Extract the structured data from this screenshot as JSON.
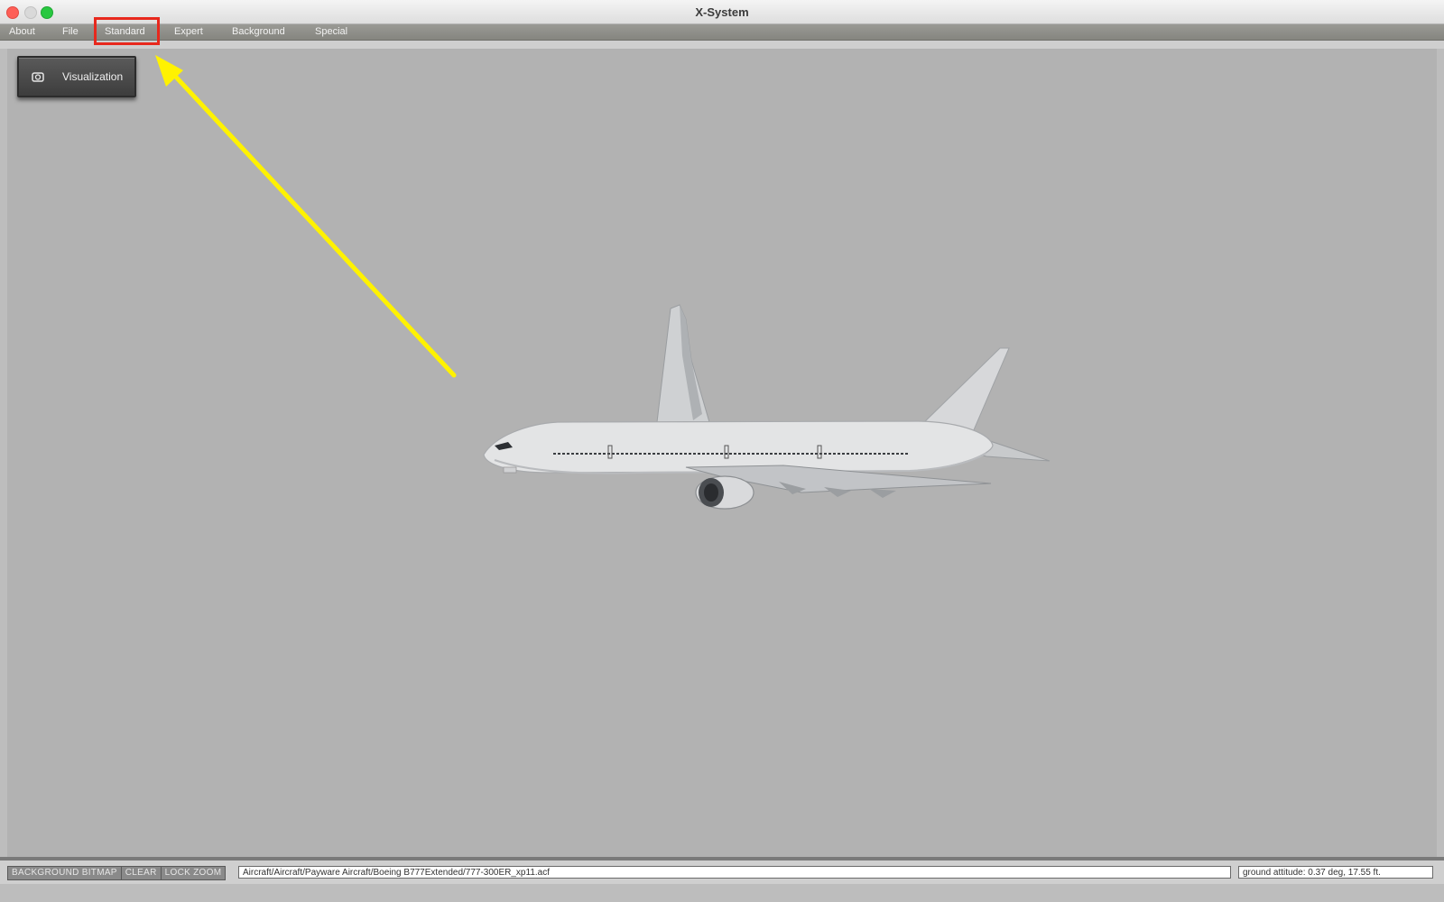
{
  "window": {
    "title": "X-System"
  },
  "menu": {
    "items": [
      "About",
      "File",
      "Standard",
      "Expert",
      "Background",
      "Special"
    ]
  },
  "viewport": {
    "visualization_label": "Visualization"
  },
  "statusbar": {
    "buttons": [
      "BACKGROUND BITMAP",
      "CLEAR",
      "LOCK ZOOM"
    ],
    "path": "Aircraft/Aircraft/Payware Aircraft/Boeing B777Extended/777-300ER_xp11.acf",
    "attitude": "ground attitude: 0.37 deg, 17.55 ft."
  },
  "colors": {
    "highlight": "#e8281d",
    "arrow": "#fff200",
    "viewport_bg": "#b2b2b2"
  }
}
